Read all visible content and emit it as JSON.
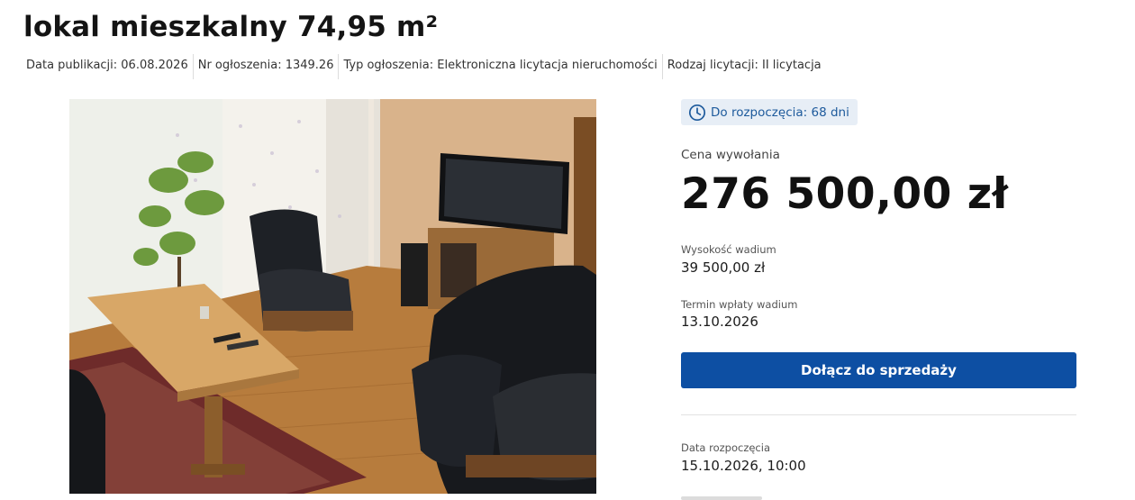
{
  "listing": {
    "title": "lokal mieszkalny 74,95 m²",
    "meta": [
      "Data publikacji: 06.08.2026",
      "Nr ogłoszenia: 1349.26",
      "Typ ogłoszenia: Elektroniczna licytacja nieruchomości",
      "Rodzaj licytacji: II licytacja"
    ]
  },
  "auction": {
    "countdown": "Do rozpoczęcia: 68 dni",
    "price_label": "Cena wywołania",
    "price": "276 500,00 zł",
    "deposit_label": "Wysokość wadium",
    "deposit": "39 500,00 zł",
    "deposit_deadline_label": "Termin wpłaty wadium",
    "deposit_deadline": "13.10.2026",
    "join_button": "Dołącz do sprzedaży",
    "start_label": "Data rozpoczęcia",
    "start": "15.10.2026, 10:00"
  },
  "icons": {
    "countdown": "clock-icon"
  },
  "colors": {
    "accent": "#0d4fa3",
    "badge_bg": "#e7eef6",
    "badge_text": "#1d5a9c"
  }
}
